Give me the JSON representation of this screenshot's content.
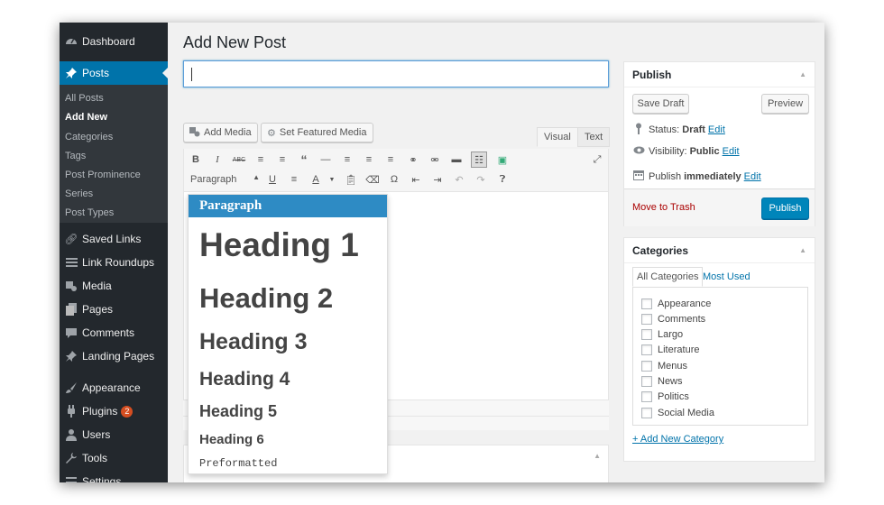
{
  "sidebar": {
    "dashboard": "Dashboard",
    "posts": "Posts",
    "submenu": [
      "All Posts",
      "Add New",
      "Categories",
      "Tags",
      "Post Prominence",
      "Series",
      "Post Types"
    ],
    "saved_links": "Saved Links",
    "link_roundups": "Link Roundups",
    "media": "Media",
    "pages": "Pages",
    "comments": "Comments",
    "landing_pages": "Landing Pages",
    "appearance": "Appearance",
    "plugins": "Plugins",
    "plugins_badge": "2",
    "users": "Users",
    "tools": "Tools",
    "settings": "Settings"
  },
  "main": {
    "title": "Add New Post",
    "add_media": "Add Media",
    "set_featured_media": "Set Featured Media",
    "tab_visual": "Visual",
    "tab_text": "Text",
    "format_select": "Paragraph"
  },
  "format_menu": {
    "paragraph": "Paragraph",
    "h1": "Heading 1",
    "h2": "Heading 2",
    "h3": "Heading 3",
    "h4": "Heading 4",
    "h5": "Heading 5",
    "h6": "Heading 6",
    "pre": "Preformatted"
  },
  "publish": {
    "heading": "Publish",
    "save_draft": "Save Draft",
    "preview": "Preview",
    "status_label": "Status:",
    "status_value": "Draft",
    "visibility_label": "Visibility:",
    "visibility_value": "Public",
    "publish_label": "Publish",
    "publish_value": "immediately",
    "edit": "Edit",
    "move_to_trash": "Move to Trash",
    "publish_button": "Publish"
  },
  "categories": {
    "heading": "Categories",
    "tab_all": "All Categories",
    "tab_most_used": "Most Used",
    "items": [
      "Appearance",
      "Comments",
      "Largo",
      "Literature",
      "Menus",
      "News",
      "Politics",
      "Social Media"
    ],
    "add_new": "+ Add New Category"
  },
  "colors": {
    "admin_bar": "#23282d",
    "accent": "#0073aa",
    "selected_format": "#2e8bc4",
    "trash": "#a00"
  }
}
